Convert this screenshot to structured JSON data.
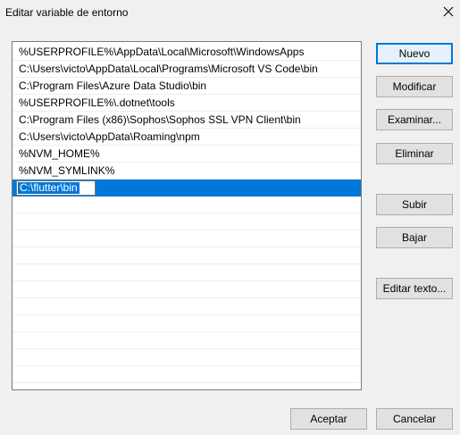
{
  "window": {
    "title": "Editar variable de entorno",
    "close_icon": "close-icon"
  },
  "paths": [
    "%USERPROFILE%\\AppData\\Local\\Microsoft\\WindowsApps",
    "C:\\Users\\victo\\AppData\\Local\\Programs\\Microsoft VS Code\\bin",
    "C:\\Program Files\\Azure Data Studio\\bin",
    "%USERPROFILE%\\.dotnet\\tools",
    "C:\\Program Files (x86)\\Sophos\\Sophos SSL VPN Client\\bin",
    "C:\\Users\\victo\\AppData\\Roaming\\npm",
    "%NVM_HOME%",
    "%NVM_SYMLINK%"
  ],
  "editing": {
    "value": "C:\\flutter\\bin"
  },
  "buttons": {
    "new": "Nuevo",
    "edit": "Modificar",
    "browse": "Examinar...",
    "delete": "Eliminar",
    "up": "Subir",
    "down": "Bajar",
    "edit_text": "Editar texto...",
    "accept": "Aceptar",
    "cancel": "Cancelar"
  },
  "colors": {
    "selection": "#0078d7",
    "primary_border": "#0078d7"
  }
}
